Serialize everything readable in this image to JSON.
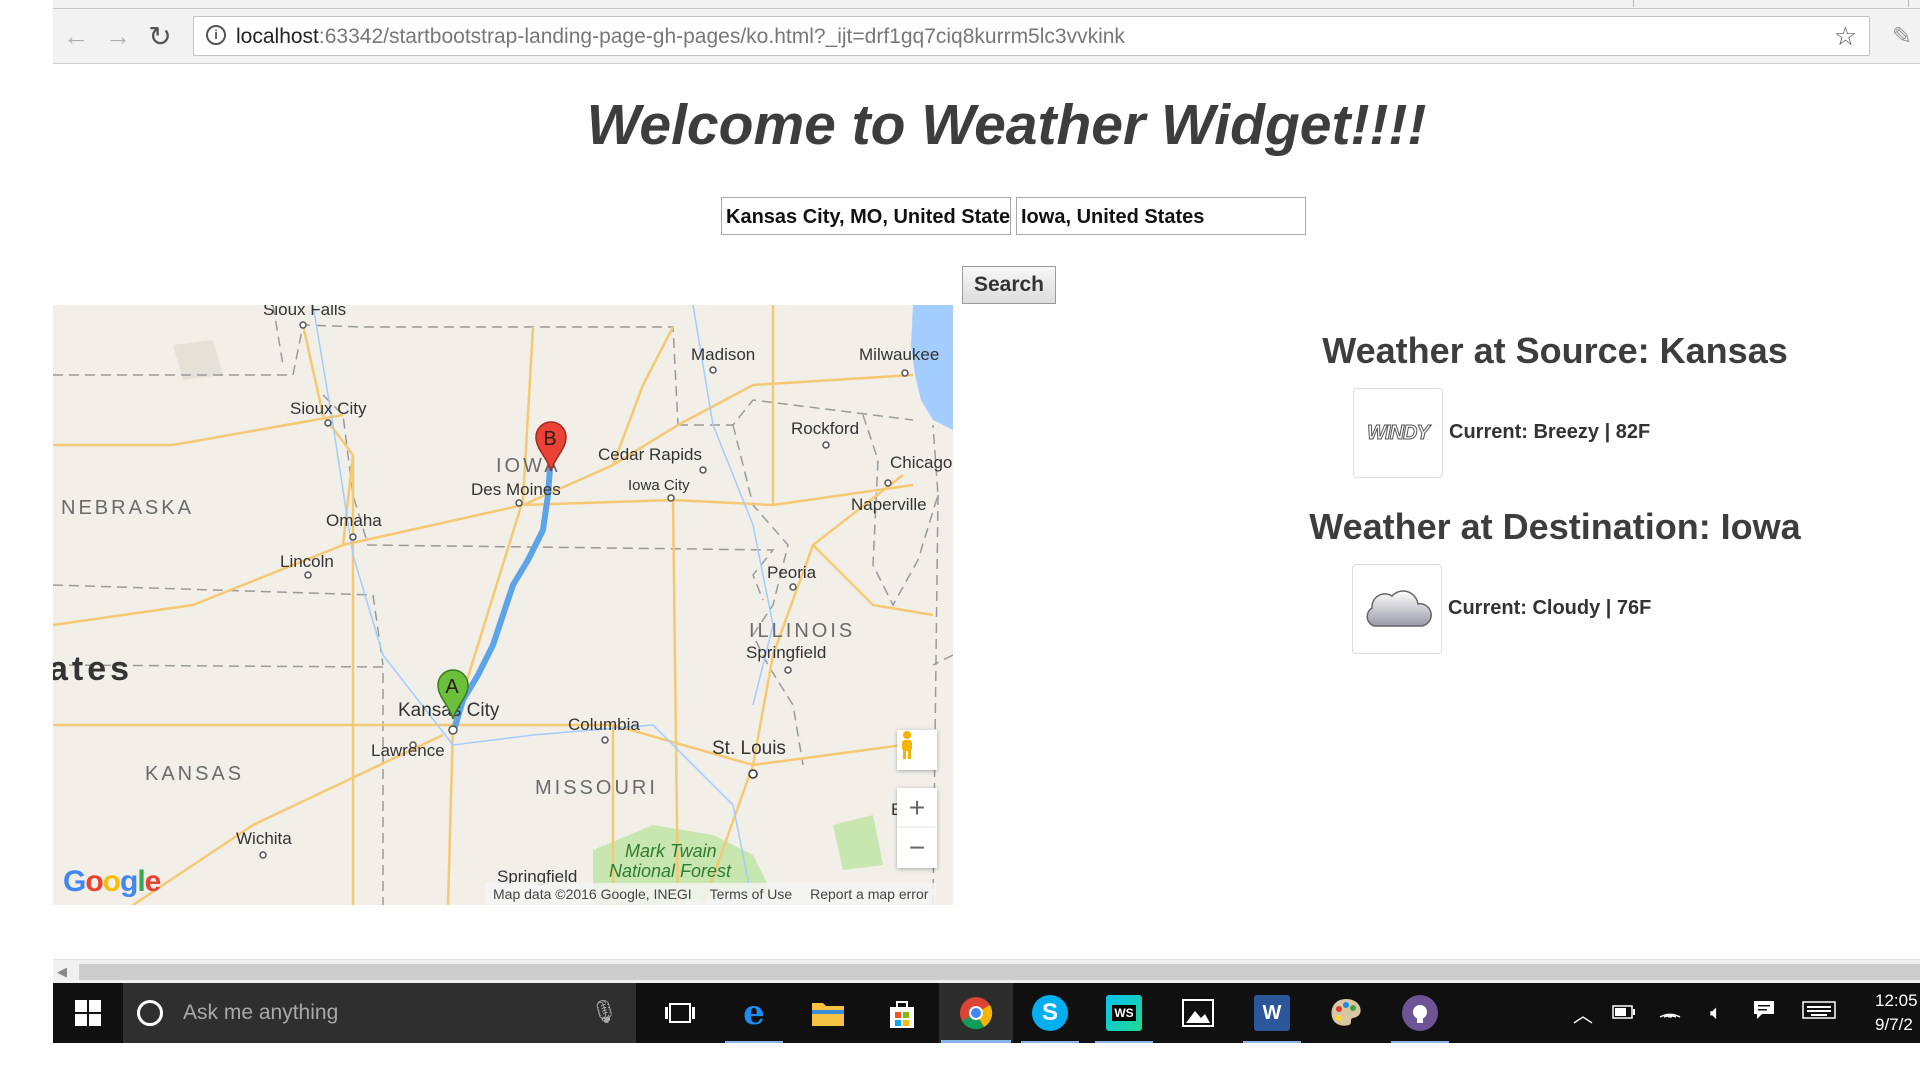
{
  "browser": {
    "url_host": "localhost",
    "url_rest": ":63342/startbootstrap-landing-page-gh-pages/ko.html?_ijt=drf1gq7ciq8kurrm5lc3vvkink",
    "info_icon": "info-icon",
    "star_icon": "bookmark-star-icon"
  },
  "page": {
    "title": "Welcome to Weather Widget!!!!",
    "source_input_value": "Kansas City, MO, United States",
    "destination_input_value": "Iowa, United States",
    "search_label": "Search"
  },
  "map": {
    "labels": {
      "sioux_falls": "Sioux Falls",
      "madison": "Madison",
      "milwaukee": "Milwaukee",
      "sioux_city": "Sioux City",
      "rockford": "Rockford",
      "iowa": "IOWA",
      "cedar_rapids": "Cedar Rapids",
      "chicago": "Chicago",
      "des_moines": "Des Moines",
      "iowa_city": "Iowa City",
      "nebraska": "NEBRASKA",
      "naperville": "Naperville",
      "omaha": "Omaha",
      "lincoln": "Lincoln",
      "peoria": "Peoria",
      "illinois": "ILLINOIS",
      "springfield_il": "Springfield",
      "ates": "ates",
      "kansas_city": "Kansas City",
      "columbia": "Columbia",
      "lawrence": "Lawrence",
      "st_louis": "St. Louis",
      "kansas": "KANSAS",
      "missouri": "MISSOURI",
      "wichita": "Wichita",
      "mark_twain": "Mark Twain",
      "national_forest": "National Forest",
      "springfield_mo": "Springfield",
      "e_vil": "E        vil"
    },
    "marker_a": "A",
    "marker_b": "B",
    "google_logo": [
      "G",
      "o",
      "o",
      "g",
      "l",
      "e"
    ],
    "attribution": {
      "data": "Map data ©2016 Google, INEGI",
      "terms": "Terms of Use",
      "report": "Report a map error"
    },
    "zoom_in": "+",
    "zoom_out": "−",
    "colors": {
      "route": "#5ba4ea",
      "marker_a": "#6bbf3a",
      "marker_b": "#ea4335",
      "water": "#a3ccff",
      "park": "#c8e6b0"
    }
  },
  "weather": {
    "source_heading": "Weather at Source: Kansas",
    "source_icon_text": "WINDY",
    "source_current": "Current: Breezy | 82F",
    "destination_heading": "Weather at Destination: Iowa",
    "destination_current": "Current: Cloudy | 76F",
    "destination_icon": "cloud-icon"
  },
  "taskbar": {
    "search_placeholder": "Ask me anything",
    "apps": [
      "task-view-icon",
      "edge-icon",
      "file-explorer-icon",
      "store-icon",
      "chrome-icon",
      "skype-icon",
      "webstorm-icon",
      "photos-icon",
      "word-icon",
      "paint-icon",
      "github-icon"
    ],
    "webstorm_label": "WS",
    "word_label": "W",
    "clock_time": "12:05",
    "clock_date": "9/7/2"
  }
}
